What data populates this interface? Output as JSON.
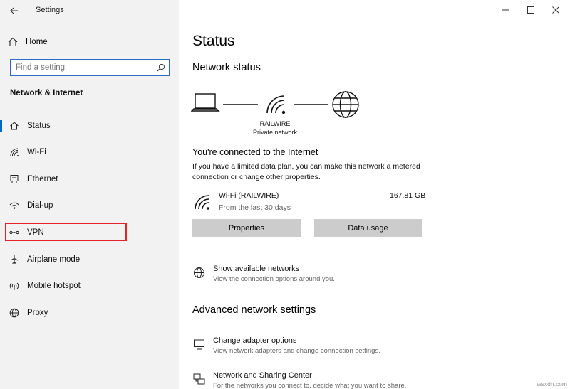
{
  "window": {
    "title": "Settings",
    "controls": [
      "minimize",
      "maximize",
      "close"
    ]
  },
  "sidebar": {
    "home_label": "Home",
    "search": {
      "placeholder": "Find a setting",
      "value": ""
    },
    "section_title": "Network & Internet",
    "items": [
      {
        "label": "Status",
        "icon": "home-icon",
        "active": true
      },
      {
        "label": "Wi-Fi",
        "icon": "wifi-icon",
        "active": false
      },
      {
        "label": "Ethernet",
        "icon": "ethernet-icon",
        "active": false
      },
      {
        "label": "Dial-up",
        "icon": "dialup-icon",
        "active": false
      },
      {
        "label": "VPN",
        "icon": "vpn-icon",
        "active": false,
        "highlighted": true
      },
      {
        "label": "Airplane mode",
        "icon": "airplane-icon",
        "active": false
      },
      {
        "label": "Mobile hotspot",
        "icon": "hotspot-icon",
        "active": false
      },
      {
        "label": "Proxy",
        "icon": "globe-icon",
        "active": false
      }
    ]
  },
  "main": {
    "title": "Status",
    "network_status_title": "Network status",
    "network": {
      "name": "RAILWIRE",
      "type": "Private network"
    },
    "connected_heading": "You're connected to the Internet",
    "connected_desc": "If you have a limited data plan, you can make this network a metered connection or change other properties.",
    "wifi": {
      "name": "Wi-Fi (RAILWIRE)",
      "sub": "From the last 30 days",
      "usage": "167.81 GB"
    },
    "buttons": {
      "properties": "Properties",
      "data_usage": "Data usage"
    },
    "show_networks": {
      "title": "Show available networks",
      "desc": "View the connection options around you."
    },
    "advanced_title": "Advanced network settings",
    "adapter": {
      "title": "Change adapter options",
      "desc": "View network adapters and change connection settings."
    },
    "sharing": {
      "title": "Network and Sharing Center",
      "desc": "For the networks you connect to, decide what you want to share."
    }
  },
  "watermark": "wsxdn.com",
  "colors": {
    "accent": "#0067c0",
    "highlight_box": "#e8202a",
    "search_border": "#2b6cc2",
    "button_bg": "#cccccc"
  }
}
